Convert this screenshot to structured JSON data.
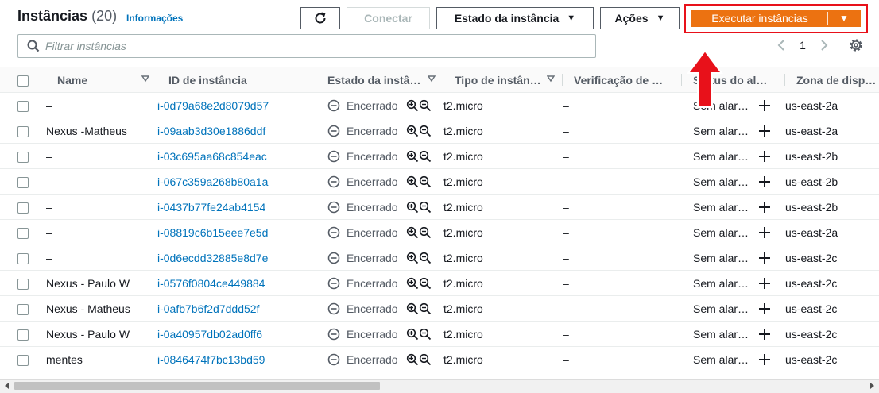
{
  "header": {
    "title": "Instâncias",
    "count": "(20)",
    "info_link": "Informações"
  },
  "toolbar": {
    "connect_label": "Conectar",
    "state_label": "Estado da instância",
    "actions_label": "Ações",
    "launch_label": "Executar instâncias"
  },
  "filter": {
    "placeholder": "Filtrar instâncias"
  },
  "pagination": {
    "page": "1"
  },
  "colors": {
    "accent": "#ec7211",
    "link": "#0073bb",
    "highlight": "#e8111a"
  },
  "table": {
    "columns": [
      "Name",
      "ID de instância",
      "Estado da instância",
      "Tipo de instância",
      "Verificação de status",
      "Status do alarme",
      "Zona de disponibilidade"
    ],
    "rows": [
      {
        "name": "–",
        "id": "i-0d79a68e2d8079d57",
        "state": "Encerrado",
        "type": "t2.micro",
        "check": "–",
        "alarm": "Sem alarmes",
        "zone": "us-east-2a"
      },
      {
        "name": "Nexus -Matheus",
        "id": "i-09aab3d30e1886ddf",
        "state": "Encerrado",
        "type": "t2.micro",
        "check": "–",
        "alarm": "Sem alarmes",
        "zone": "us-east-2a"
      },
      {
        "name": "–",
        "id": "i-03c695aa68c854eac",
        "state": "Encerrado",
        "type": "t2.micro",
        "check": "–",
        "alarm": "Sem alarmes",
        "zone": "us-east-2b"
      },
      {
        "name": "–",
        "id": "i-067c359a268b80a1a",
        "state": "Encerrado",
        "type": "t2.micro",
        "check": "–",
        "alarm": "Sem alarmes",
        "zone": "us-east-2b"
      },
      {
        "name": "–",
        "id": "i-0437b77fe24ab4154",
        "state": "Encerrado",
        "type": "t2.micro",
        "check": "–",
        "alarm": "Sem alarmes",
        "zone": "us-east-2b"
      },
      {
        "name": "–",
        "id": "i-08819c6b15eee7e5d",
        "state": "Encerrado",
        "type": "t2.micro",
        "check": "–",
        "alarm": "Sem alarmes",
        "zone": "us-east-2a"
      },
      {
        "name": "–",
        "id": "i-0d6ecdd32885e8d7e",
        "state": "Encerrado",
        "type": "t2.micro",
        "check": "–",
        "alarm": "Sem alarmes",
        "zone": "us-east-2c"
      },
      {
        "name": "Nexus - Paulo W",
        "id": "i-0576f0804ce449884",
        "state": "Encerrado",
        "type": "t2.micro",
        "check": "–",
        "alarm": "Sem alarmes",
        "zone": "us-east-2c"
      },
      {
        "name": "Nexus - Matheus",
        "id": "i-0afb7b6f2d7ddd52f",
        "state": "Encerrado",
        "type": "t2.micro",
        "check": "–",
        "alarm": "Sem alarmes",
        "zone": "us-east-2c"
      },
      {
        "name": "Nexus - Paulo W",
        "id": "i-0a40957db02ad0ff6",
        "state": "Encerrado",
        "type": "t2.micro",
        "check": "–",
        "alarm": "Sem alarmes",
        "zone": "us-east-2c"
      },
      {
        "name": "mentes",
        "id": "i-0846474f7bc13bd59",
        "state": "Encerrado",
        "type": "t2.micro",
        "check": "–",
        "alarm": "Sem alarmes",
        "zone": "us-east-2c"
      }
    ]
  }
}
